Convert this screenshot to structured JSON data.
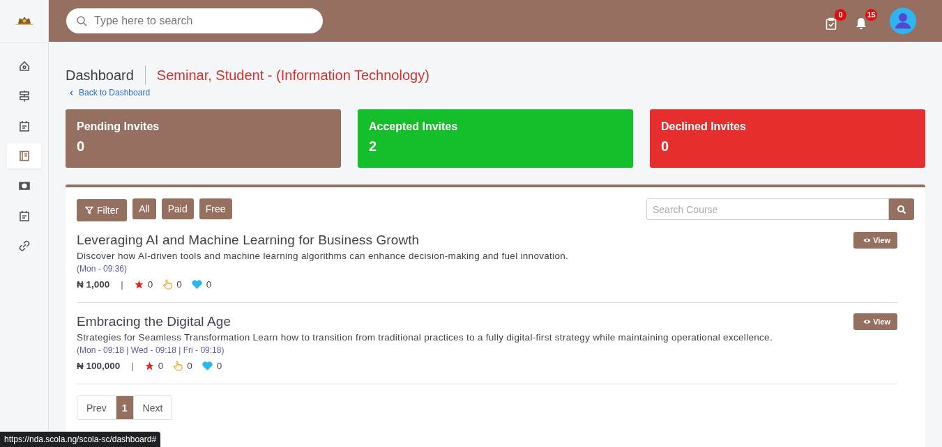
{
  "topbar": {
    "search": {
      "placeholder": "Type here to search"
    },
    "tasks_badge": "0",
    "notifications_badge": "15"
  },
  "sidebar": {
    "items": [
      {
        "kind": "home",
        "selected": false
      },
      {
        "kind": "signpost",
        "selected": false
      },
      {
        "kind": "calendar",
        "selected": false
      },
      {
        "kind": "book",
        "selected": true
      },
      {
        "kind": "money",
        "selected": false
      },
      {
        "kind": "calendar",
        "selected": false
      },
      {
        "kind": "link",
        "selected": false
      }
    ]
  },
  "header": {
    "title": "Dashboard",
    "subtitle": "Seminar, Student - (Information Technology)",
    "back_link": "Back to Dashboard"
  },
  "stats": [
    {
      "label": "Pending Invites",
      "value": "0",
      "color": "#957060"
    },
    {
      "label": "Accepted Invites",
      "value": "2",
      "color": "#14bf2a"
    },
    {
      "label": "Declined Invites",
      "value": "0",
      "color": "#e62e2e"
    }
  ],
  "filters": {
    "filter_button": "Filter",
    "options": [
      {
        "label": "All",
        "selected": false
      },
      {
        "label": "Paid",
        "selected": false
      },
      {
        "label": "Free",
        "selected": false
      }
    ],
    "search": {
      "placeholder": "Search Course"
    }
  },
  "courses": [
    {
      "title": "Leveraging AI and Machine Learning for Business Growth",
      "description": "Discover how AI-driven tools and machine learning algorithms can enhance decision-making and fuel innovation.",
      "schedule": "(Mon - 09:36)",
      "price": "₦ 1,000",
      "separator": "|",
      "ratings": "0",
      "likes": "0",
      "favorites": "0",
      "view_button": "View"
    },
    {
      "title": "Embracing the Digital Age",
      "description": "Strategies for Seamless Transformation Learn how to transition from traditional practices to a fully digital-first strategy while maintaining operational excellence.",
      "schedule": "(Mon - 09:18 | Wed - 09:18 | Fri - 09:18)",
      "price": "₦ 100,000",
      "separator": "|",
      "ratings": "0",
      "likes": "0",
      "favorites": "0",
      "view_button": "View"
    }
  ],
  "pagination": {
    "prev": "Prev",
    "pages": [
      {
        "label": "1",
        "selected": true
      }
    ],
    "next": "Next"
  },
  "status_url": "https://nda.scola.ng/scola-sc/dashboard#"
}
